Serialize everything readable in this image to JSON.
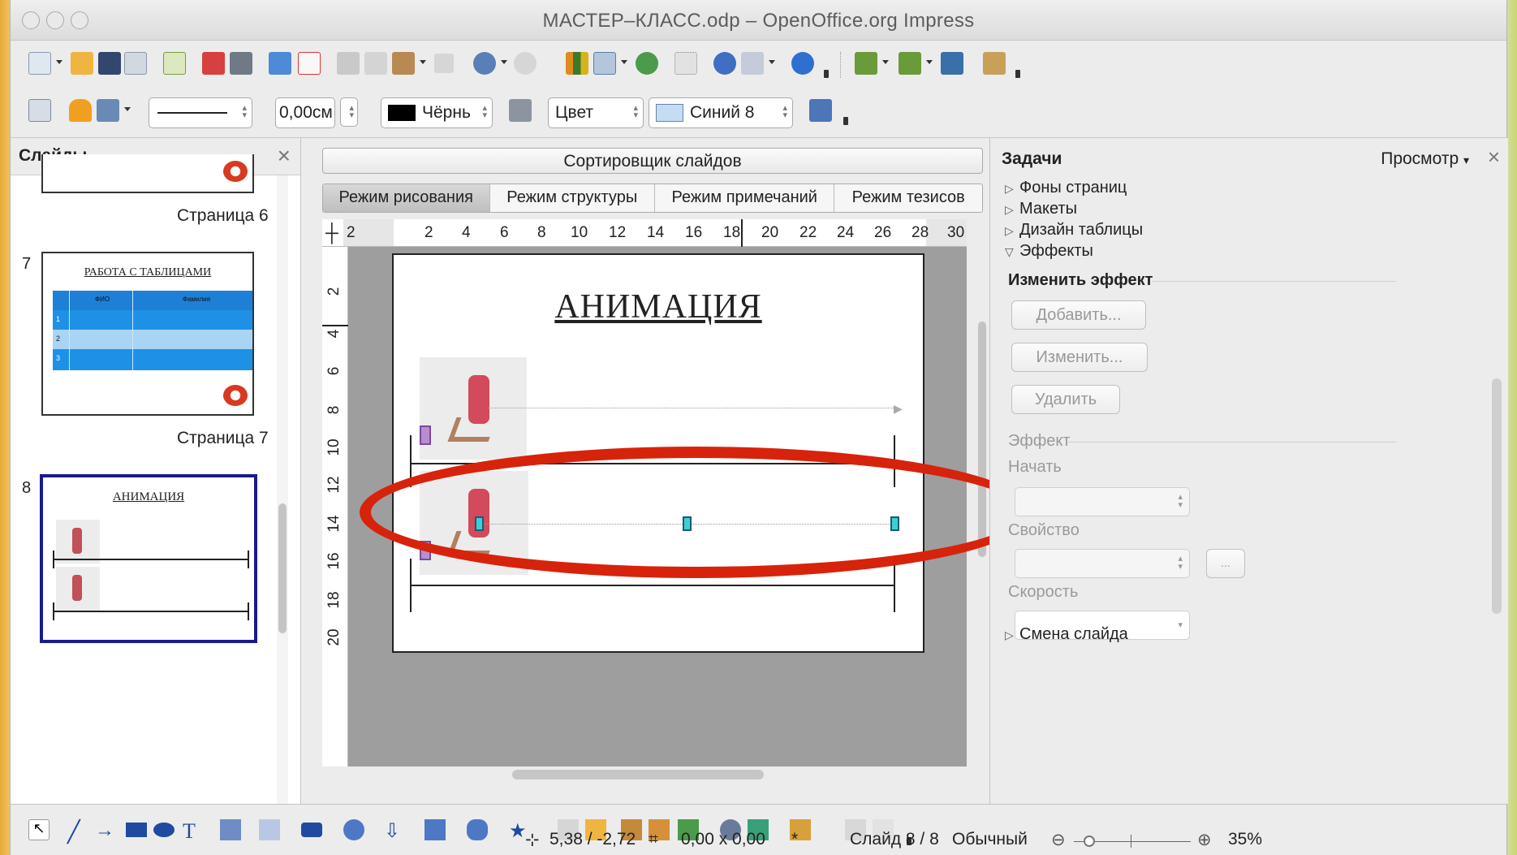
{
  "window": {
    "title": "МАСТЕР–КЛАСС.odp – OpenOffice.org Impress"
  },
  "toolbar2": {
    "line_width": "0,00см",
    "line_color": "Чёрнь",
    "area_style": "Цвет",
    "area_color": "Синий 8"
  },
  "slides_panel": {
    "title": "Слайды",
    "close": "×",
    "thumbs": [
      {
        "number": "",
        "label": "Страница 6"
      },
      {
        "number": "7",
        "label": "Страница 7",
        "slide_title": "РАБОТА С ТАБЛИЦАМИ",
        "table_header": [
          "ФИО",
          "Фамилия"
        ],
        "table_rows": [
          "1",
          "2",
          "3"
        ]
      },
      {
        "number": "8",
        "label": "",
        "slide_title": "АНИМАЦИЯ"
      }
    ]
  },
  "center": {
    "sorter": "Сортировщик слайдов",
    "tabs": [
      "Режим рисования",
      "Режим структуры",
      "Режим примечаний",
      "Режим тезисов"
    ],
    "active_tab": "Режим рисования",
    "ruler_h": [
      "2",
      "2",
      "4",
      "6",
      "8",
      "10",
      "12",
      "14",
      "16",
      "18",
      "20",
      "22",
      "24",
      "26",
      "28",
      "30"
    ],
    "ruler_v": [
      "2",
      "4",
      "6",
      "8",
      "10",
      "12",
      "14",
      "16",
      "18",
      "20"
    ],
    "slide_title": "АНИМАЦИЯ"
  },
  "tasks_panel": {
    "title": "Задачи",
    "view": "Просмотр",
    "close": "×",
    "sections": [
      "Фоны страниц",
      "Макеты",
      "Дизайн таблицы",
      "Эффекты",
      "Смена слайда"
    ],
    "effects": {
      "change_effect": "Изменить эффект",
      "add": "Добавить...",
      "modify": "Изменить...",
      "remove": "Удалить",
      "effect_group": "Эффект",
      "start": "Начать",
      "property": "Свойство",
      "property_btn": "...",
      "speed": "Скорость"
    }
  },
  "status": {
    "position": "5,38 / -2,72",
    "size": "0,00 x 0,00",
    "modified": "*",
    "slide": "Слайд 8 / 8",
    "layout": "Обычный",
    "zoom": "35%"
  },
  "colors": {
    "annotation": "#d7230b",
    "table_blue": "#1e90e6",
    "table_light": "#a9d4f4",
    "selected_border": "#1a1a8a",
    "marker": "#3ed0d0"
  }
}
